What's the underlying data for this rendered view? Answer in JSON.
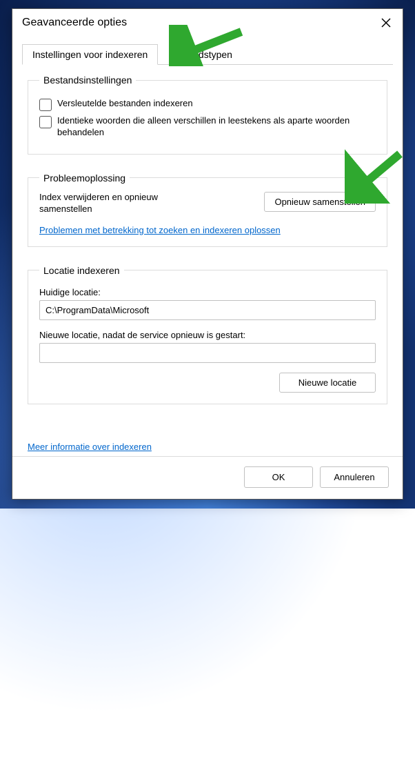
{
  "window": {
    "title": "Geavanceerde opties"
  },
  "tabs": {
    "indexing": "Instellingen voor indexeren",
    "filetypes": "Bestandstypen"
  },
  "file_settings": {
    "legend": "Bestandsinstellingen",
    "opt_encrypted": "Versleutelde bestanden indexeren",
    "opt_diacritics": "Identieke woorden die alleen verschillen in leestekens als aparte woorden behandelen"
  },
  "troubleshoot": {
    "legend": "Probleemoplossing",
    "rebuild_text": "Index verwijderen en opnieuw samenstellen",
    "rebuild_btn": "Opnieuw samenstellen",
    "help_link": "Problemen met betrekking tot zoeken en indexeren oplossen"
  },
  "index_location": {
    "legend": "Locatie indexeren",
    "current_label": "Huidige locatie:",
    "current_value": "C:\\ProgramData\\Microsoft",
    "new_label": "Nieuwe locatie, nadat de service opnieuw is gestart:",
    "new_value": "",
    "new_btn": "Nieuwe locatie"
  },
  "more_link": "Meer informatie over indexeren",
  "buttons": {
    "ok": "OK",
    "cancel": "Annuleren"
  }
}
